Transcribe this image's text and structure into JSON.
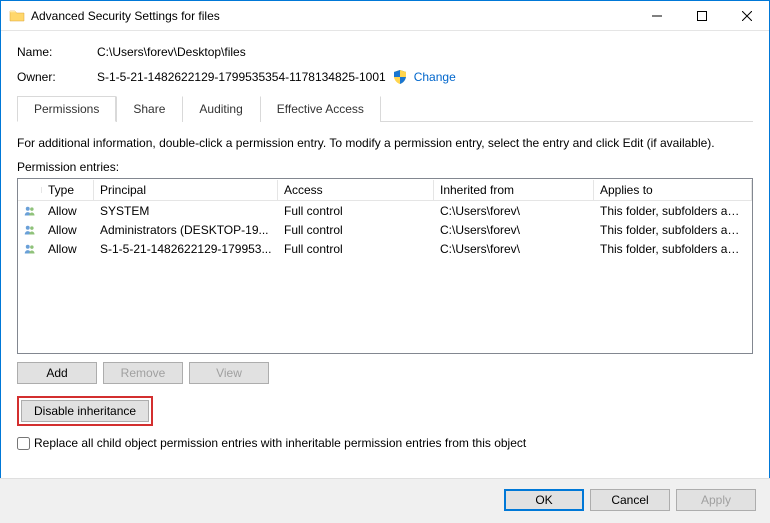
{
  "titlebar": {
    "title": "Advanced Security Settings for files"
  },
  "name": {
    "label": "Name:",
    "value": "C:\\Users\\forev\\Desktop\\files"
  },
  "owner": {
    "label": "Owner:",
    "value": "S-1-5-21-1482622129-1799535354-1178134825-1001",
    "change_label": "Change"
  },
  "tabs": {
    "permissions": "Permissions",
    "share": "Share",
    "auditing": "Auditing",
    "effective": "Effective Access"
  },
  "info_text": "For additional information, double-click a permission entry. To modify a permission entry, select the entry and click Edit (if available).",
  "entries_label": "Permission entries:",
  "columns": {
    "type": "Type",
    "principal": "Principal",
    "access": "Access",
    "inherited": "Inherited from",
    "applies": "Applies to"
  },
  "rows": [
    {
      "type": "Allow",
      "principal": "SYSTEM",
      "access": "Full control",
      "inherited": "C:\\Users\\forev\\",
      "applies": "This folder, subfolders and files"
    },
    {
      "type": "Allow",
      "principal": "Administrators (DESKTOP-19...",
      "access": "Full control",
      "inherited": "C:\\Users\\forev\\",
      "applies": "This folder, subfolders and files"
    },
    {
      "type": "Allow",
      "principal": "S-1-5-21-1482622129-179953...",
      "access": "Full control",
      "inherited": "C:\\Users\\forev\\",
      "applies": "This folder, subfolders and files"
    }
  ],
  "buttons": {
    "add": "Add",
    "remove": "Remove",
    "view": "View",
    "disable_inheritance": "Disable inheritance",
    "ok": "OK",
    "cancel": "Cancel",
    "apply": "Apply"
  },
  "replace_label": "Replace all child object permission entries with inheritable permission entries from this object"
}
